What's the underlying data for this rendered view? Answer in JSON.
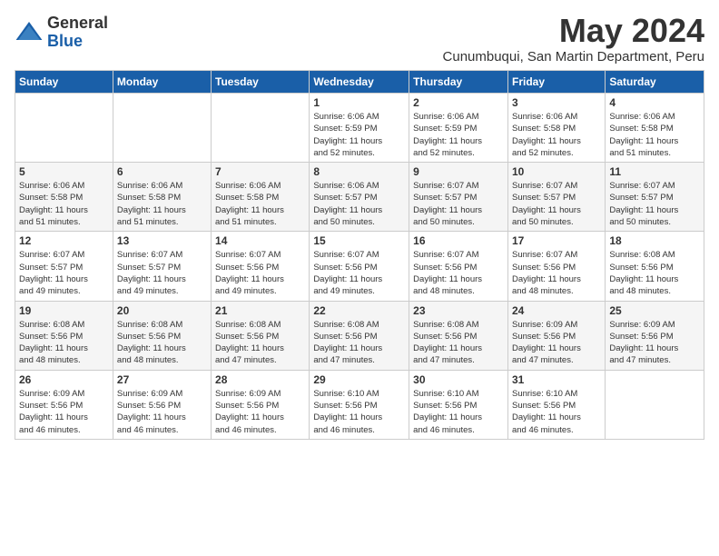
{
  "header": {
    "logo_general": "General",
    "logo_blue": "Blue",
    "month_title": "May 2024",
    "subtitle": "Cunumbuqui, San Martin Department, Peru"
  },
  "days_of_week": [
    "Sunday",
    "Monday",
    "Tuesday",
    "Wednesday",
    "Thursday",
    "Friday",
    "Saturday"
  ],
  "weeks": [
    [
      {
        "day": "",
        "info": ""
      },
      {
        "day": "",
        "info": ""
      },
      {
        "day": "",
        "info": ""
      },
      {
        "day": "1",
        "info": "Sunrise: 6:06 AM\nSunset: 5:59 PM\nDaylight: 11 hours\nand 52 minutes."
      },
      {
        "day": "2",
        "info": "Sunrise: 6:06 AM\nSunset: 5:59 PM\nDaylight: 11 hours\nand 52 minutes."
      },
      {
        "day": "3",
        "info": "Sunrise: 6:06 AM\nSunset: 5:58 PM\nDaylight: 11 hours\nand 52 minutes."
      },
      {
        "day": "4",
        "info": "Sunrise: 6:06 AM\nSunset: 5:58 PM\nDaylight: 11 hours\nand 51 minutes."
      }
    ],
    [
      {
        "day": "5",
        "info": "Sunrise: 6:06 AM\nSunset: 5:58 PM\nDaylight: 11 hours\nand 51 minutes."
      },
      {
        "day": "6",
        "info": "Sunrise: 6:06 AM\nSunset: 5:58 PM\nDaylight: 11 hours\nand 51 minutes."
      },
      {
        "day": "7",
        "info": "Sunrise: 6:06 AM\nSunset: 5:58 PM\nDaylight: 11 hours\nand 51 minutes."
      },
      {
        "day": "8",
        "info": "Sunrise: 6:06 AM\nSunset: 5:57 PM\nDaylight: 11 hours\nand 50 minutes."
      },
      {
        "day": "9",
        "info": "Sunrise: 6:07 AM\nSunset: 5:57 PM\nDaylight: 11 hours\nand 50 minutes."
      },
      {
        "day": "10",
        "info": "Sunrise: 6:07 AM\nSunset: 5:57 PM\nDaylight: 11 hours\nand 50 minutes."
      },
      {
        "day": "11",
        "info": "Sunrise: 6:07 AM\nSunset: 5:57 PM\nDaylight: 11 hours\nand 50 minutes."
      }
    ],
    [
      {
        "day": "12",
        "info": "Sunrise: 6:07 AM\nSunset: 5:57 PM\nDaylight: 11 hours\nand 49 minutes."
      },
      {
        "day": "13",
        "info": "Sunrise: 6:07 AM\nSunset: 5:57 PM\nDaylight: 11 hours\nand 49 minutes."
      },
      {
        "day": "14",
        "info": "Sunrise: 6:07 AM\nSunset: 5:56 PM\nDaylight: 11 hours\nand 49 minutes."
      },
      {
        "day": "15",
        "info": "Sunrise: 6:07 AM\nSunset: 5:56 PM\nDaylight: 11 hours\nand 49 minutes."
      },
      {
        "day": "16",
        "info": "Sunrise: 6:07 AM\nSunset: 5:56 PM\nDaylight: 11 hours\nand 48 minutes."
      },
      {
        "day": "17",
        "info": "Sunrise: 6:07 AM\nSunset: 5:56 PM\nDaylight: 11 hours\nand 48 minutes."
      },
      {
        "day": "18",
        "info": "Sunrise: 6:08 AM\nSunset: 5:56 PM\nDaylight: 11 hours\nand 48 minutes."
      }
    ],
    [
      {
        "day": "19",
        "info": "Sunrise: 6:08 AM\nSunset: 5:56 PM\nDaylight: 11 hours\nand 48 minutes."
      },
      {
        "day": "20",
        "info": "Sunrise: 6:08 AM\nSunset: 5:56 PM\nDaylight: 11 hours\nand 48 minutes."
      },
      {
        "day": "21",
        "info": "Sunrise: 6:08 AM\nSunset: 5:56 PM\nDaylight: 11 hours\nand 47 minutes."
      },
      {
        "day": "22",
        "info": "Sunrise: 6:08 AM\nSunset: 5:56 PM\nDaylight: 11 hours\nand 47 minutes."
      },
      {
        "day": "23",
        "info": "Sunrise: 6:08 AM\nSunset: 5:56 PM\nDaylight: 11 hours\nand 47 minutes."
      },
      {
        "day": "24",
        "info": "Sunrise: 6:09 AM\nSunset: 5:56 PM\nDaylight: 11 hours\nand 47 minutes."
      },
      {
        "day": "25",
        "info": "Sunrise: 6:09 AM\nSunset: 5:56 PM\nDaylight: 11 hours\nand 47 minutes."
      }
    ],
    [
      {
        "day": "26",
        "info": "Sunrise: 6:09 AM\nSunset: 5:56 PM\nDaylight: 11 hours\nand 46 minutes."
      },
      {
        "day": "27",
        "info": "Sunrise: 6:09 AM\nSunset: 5:56 PM\nDaylight: 11 hours\nand 46 minutes."
      },
      {
        "day": "28",
        "info": "Sunrise: 6:09 AM\nSunset: 5:56 PM\nDaylight: 11 hours\nand 46 minutes."
      },
      {
        "day": "29",
        "info": "Sunrise: 6:10 AM\nSunset: 5:56 PM\nDaylight: 11 hours\nand 46 minutes."
      },
      {
        "day": "30",
        "info": "Sunrise: 6:10 AM\nSunset: 5:56 PM\nDaylight: 11 hours\nand 46 minutes."
      },
      {
        "day": "31",
        "info": "Sunrise: 6:10 AM\nSunset: 5:56 PM\nDaylight: 11 hours\nand 46 minutes."
      },
      {
        "day": "",
        "info": ""
      }
    ]
  ]
}
